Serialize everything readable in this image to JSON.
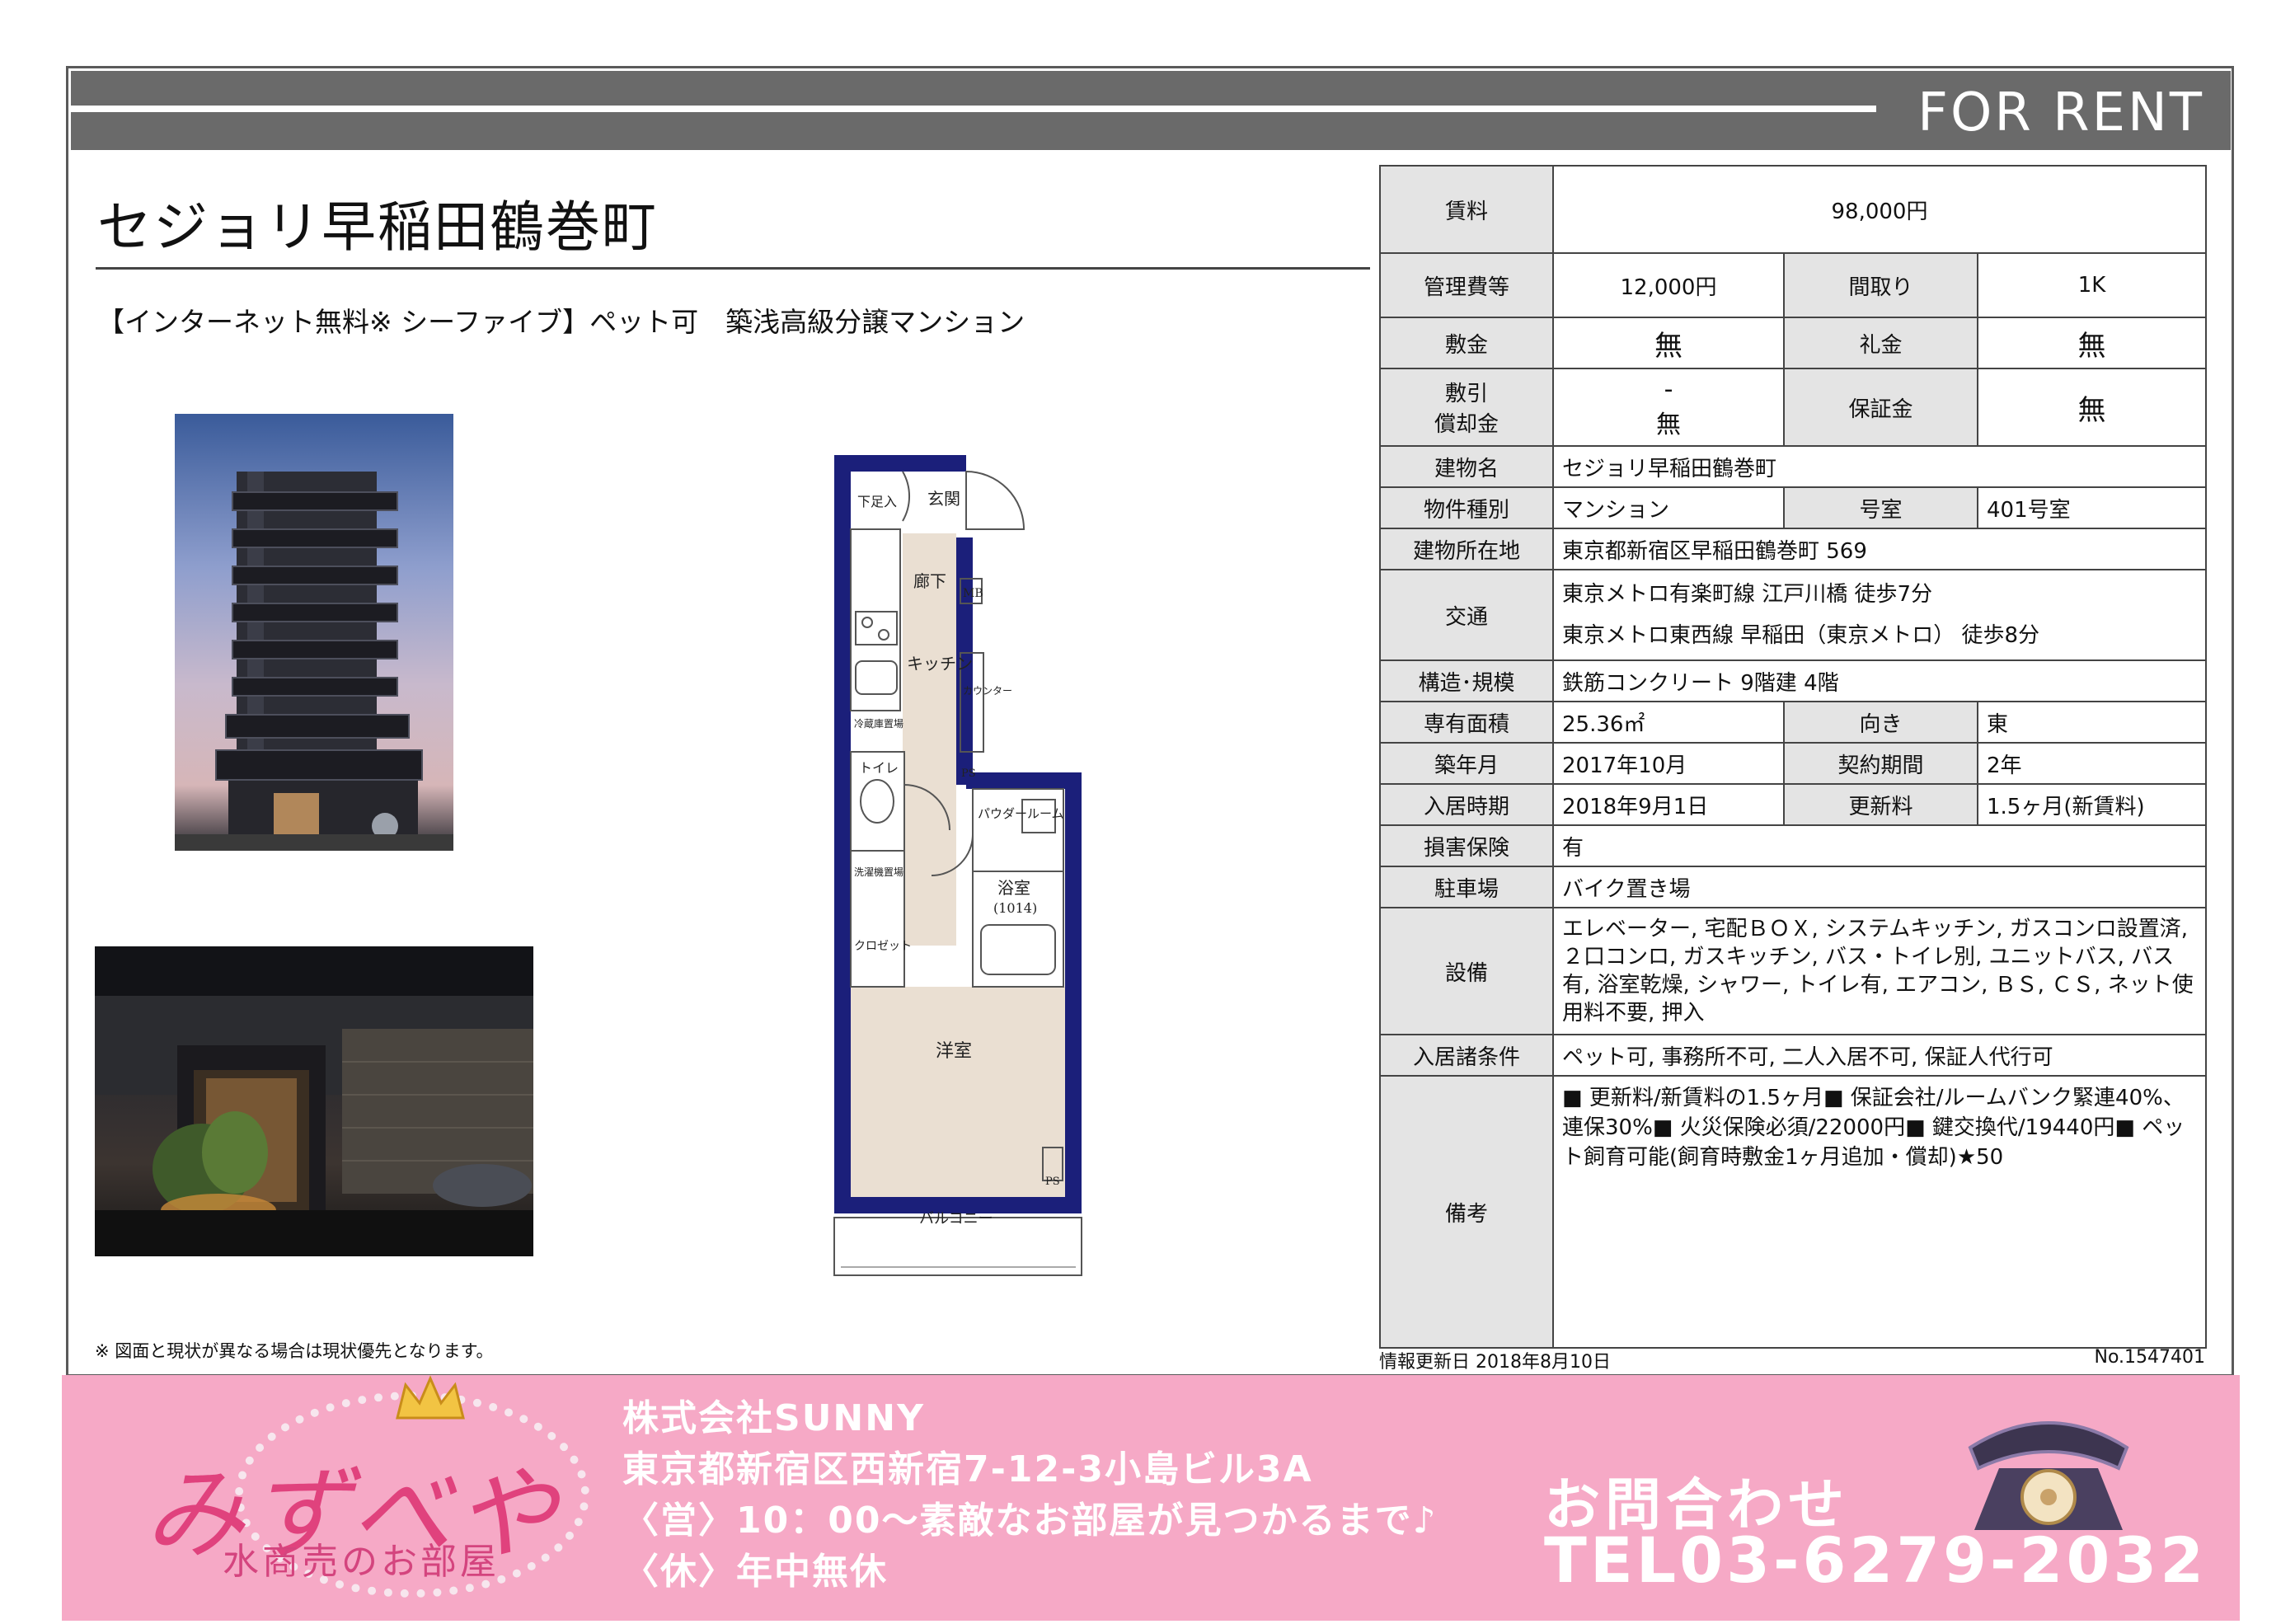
{
  "banner": {
    "label": "FOR RENT"
  },
  "property": {
    "title": "セジョリ早稲田鶴巻町",
    "catch_copy": "【インターネット無料※ シーファイブ】ペット可　築浅高級分譲マンション"
  },
  "floor_plan": {
    "rooms": {
      "entrance": "玄関",
      "shoe_box": "下足入",
      "hallway": "廊下",
      "mb": "MB",
      "kitchen": "キッチン",
      "counter": "カウンター",
      "fridge": "冷蔵庫置場",
      "toilet": "トイレ",
      "ps_1": "PS",
      "powder": "パウダールーム",
      "bath": "浴室",
      "bath_size": "(1014)",
      "washer": "洗濯機置場",
      "closet": "クロゼット",
      "western": "洋室",
      "ps_2": "PS",
      "balcony": "バルコニー"
    }
  },
  "note": "※ 図面と現状が異なる場合は現状優先となります。",
  "details": {
    "rent_label": "賃料",
    "rent": "98,000円",
    "mgmt_label": "管理費等",
    "mgmt": "12,000円",
    "layout_label": "間取り",
    "layout": "1K",
    "deposit_label": "敷金",
    "deposit": "無",
    "key_money_label": "礼金",
    "key_money": "無",
    "deduction_label_1": "敷引",
    "deduction_label_2": "償却金",
    "deduction_val_1": "-",
    "deduction_val_2": "無",
    "guarantee_label": "保証金",
    "guarantee": "無",
    "building_name_label": "建物名",
    "building_name": "セジョリ早稲田鶴巻町",
    "type_label": "物件種別",
    "type": "マンション",
    "room_no_label": "号室",
    "room_no": "401号室",
    "address_label": "建物所在地",
    "address": "東京都新宿区早稲田鶴巻町 569",
    "transit_label": "交通",
    "transit_1": "東京メトロ有楽町線 江戸川橋 徒歩7分",
    "transit_2": "東京メトロ東西線 早稲田（東京メトロ） 徒歩8分",
    "structure_label": "構造･規模",
    "structure": "鉄筋コンクリート 9階建 4階",
    "area_label": "専有面積",
    "area": "25.36㎡",
    "direction_label": "向き",
    "direction": "東",
    "built_label": "築年月",
    "built": "2017年10月",
    "contract_label": "契約期間",
    "contract": "2年",
    "move_in_label": "入居時期",
    "move_in": "2018年9月1日",
    "renewal_label": "更新料",
    "renewal": "1.5ヶ月(新賃料)",
    "insurance_label": "損害保険",
    "insurance": "有",
    "parking_label": "駐車場",
    "parking": "バイク置き場",
    "equipment_label": "設備",
    "equipment": "エレベーター, 宅配ＢＯＸ, システムキッチン, ガスコンロ設置済, ２口コンロ, ガスキッチン, バス・トイレ別, ユニットバス, バス有, 浴室乾燥, シャワー, トイレ有, エアコン, ＢＳ, ＣＳ, ネット使用料不要, 押入",
    "conditions_label": "入居諸条件",
    "conditions": "ペット可, 事務所不可, 二人入居不可, 保証人代行可",
    "remarks_label": "備考",
    "remarks": "■ 更新料/新賃料の1.5ヶ月■ 保証会社/ルームバンク緊連40%、連保30%■ 火災保険必須/22000円■ 鍵交換代/19440円■ ペット飼育可能(飼育時敷金1ヶ月追加・償却)★50"
  },
  "update": {
    "date": "情報更新日 2018年8月10日",
    "number": "No.1547401"
  },
  "footer": {
    "logo": "みずべや",
    "logo_sub": "水商売のお部屋",
    "company": "株式会社SUNNY",
    "company_address": "東京都新宿区西新宿7-12-3小島ビル3A",
    "hours": "〈営〉10：00～素敵なお部屋が見つかるまで♪",
    "holiday": "〈休〉年中無休",
    "contact_label": "お問合わせ",
    "tel": "TEL03-6279-2032"
  },
  "colors": {
    "banner_gray": "#6a6a6a",
    "label_bg": "#e4e4e4",
    "footer_pink": "#f6a9c6",
    "logo_pink": "#e0427d",
    "plan_wall": "#1b1f7a",
    "plan_floor": "#eadfd2"
  }
}
